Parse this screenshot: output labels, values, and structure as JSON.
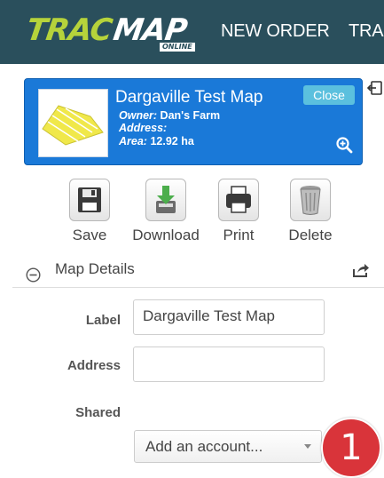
{
  "header": {
    "logo_main": "TRAC",
    "logo_secondary": "MAP",
    "logo_sub": "ONLINE",
    "nav_items": [
      "NEW ORDER",
      "TRA"
    ]
  },
  "map_card": {
    "title": "Dargaville Test Map",
    "owner_label": "Owner:",
    "owner_value": "Dan's Farm",
    "address_label": "Address:",
    "address_value": "",
    "area_label": "Area:",
    "area_value": "12.92 ha",
    "close_label": "Close"
  },
  "toolbar": {
    "save_label": "Save",
    "download_label": "Download",
    "print_label": "Print",
    "delete_label": "Delete"
  },
  "section": {
    "title": "Map Details"
  },
  "form": {
    "label_label": "Label",
    "label_value": "Dargaville Test Map",
    "address_label": "Address",
    "address_value": "",
    "shared_label": "Shared",
    "shared_select_value": "Add an account..."
  },
  "callout": {
    "number": "1"
  },
  "colors": {
    "header_bg": "#2a4f5c",
    "card_bg": "#1a79d8",
    "logo_green": "#b6d33b",
    "close_button": "#5bc0de",
    "callout_red": "#d9343a"
  }
}
